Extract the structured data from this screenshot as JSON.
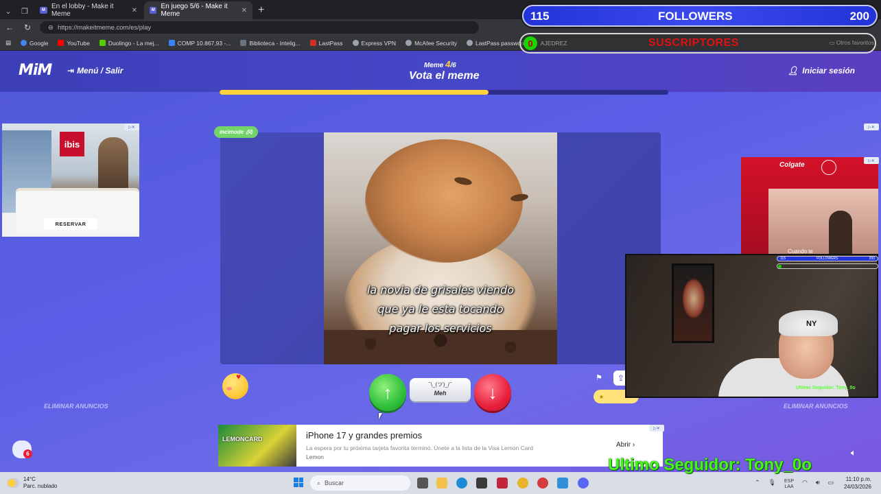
{
  "browser": {
    "tabs": [
      {
        "title": "En el lobby - Make it Meme",
        "active": false
      },
      {
        "title": "En juego 5/6 - Make it Meme",
        "active": true
      }
    ],
    "url": "https://makeitmeme.com/es/play",
    "bookmarks": [
      {
        "label": "Google",
        "color": "#4285f4"
      },
      {
        "label": "YouTube",
        "color": "#ff0000"
      },
      {
        "label": "Duolingo - La mej...",
        "color": "#58cc02"
      },
      {
        "label": "COMP 10.867,93 -...",
        "color": "#3b82f6"
      },
      {
        "label": "Biblioteca - Intelig...",
        "color": "#6b7280"
      },
      {
        "label": "LastPass",
        "color": "#d32d27"
      },
      {
        "label": "Express VPN",
        "color": "#9ca3af"
      },
      {
        "label": "McAfee Security",
        "color": "#9ca3af"
      },
      {
        "label": "LastPass password...",
        "color": "#9ca3af"
      },
      {
        "label": "AJEDREZ",
        "color": "#9ca3af"
      }
    ],
    "other_bookmarks": "Otros favoritos"
  },
  "site": {
    "logo": "MiM",
    "menu_label": "Menú / Salir",
    "meme_label": "Meme",
    "meme_current": "4",
    "meme_total": "/6",
    "vote_title": "Vota el meme",
    "login_label": "Iniciar sesión",
    "progress": 0.6,
    "remove_ads_left": "ELIMINAR ANUNCIOS",
    "remove_ads_right": "ELIMINAR ANUNCIOS",
    "author_tag": "mcimode",
    "meme_caption": [
      "la novia de grisales viendo",
      "que ya le esta tocando",
      "pagar los servicios"
    ],
    "meh_face": "¯\\_(ツ)_/¯",
    "meh_label": "Meh",
    "chat_badge": "6"
  },
  "ads": {
    "left": {
      "brand": "ibis",
      "button": "RESERVAR"
    },
    "right": {
      "brand": "Colgate",
      "caption": "Cuando te"
    },
    "bottom": {
      "thumb_text": "LEMONCARD",
      "title": "iPhone 17 y grandes premios",
      "description": "La espera por tu próxima tarjeta favorita terminó. Únete a la lista de la Visa Lemon Card",
      "brand": "Lemon",
      "cta": "Abrir"
    }
  },
  "overlay": {
    "followers_count": "115",
    "followers_label": "FOLLOWERS",
    "followers_goal": "200",
    "subs_count": "0",
    "subs_label": "SUSCRIPTORES",
    "mini_followers_count": "115",
    "mini_followers_label": "FOLLOWERS",
    "mini_followers_goal": "200",
    "cam_follower": "Ultimo Seguidor: Tony_0o",
    "last_follower": "Ultimo Seguidor: Tony_0o"
  },
  "taskbar": {
    "temperature": "14°C",
    "weather": "Parc. nublado",
    "search_placeholder": "Buscar",
    "lang": "ESP",
    "lang2": "LAA",
    "time": "11:10 p.m.",
    "date": "24/03/2026"
  }
}
